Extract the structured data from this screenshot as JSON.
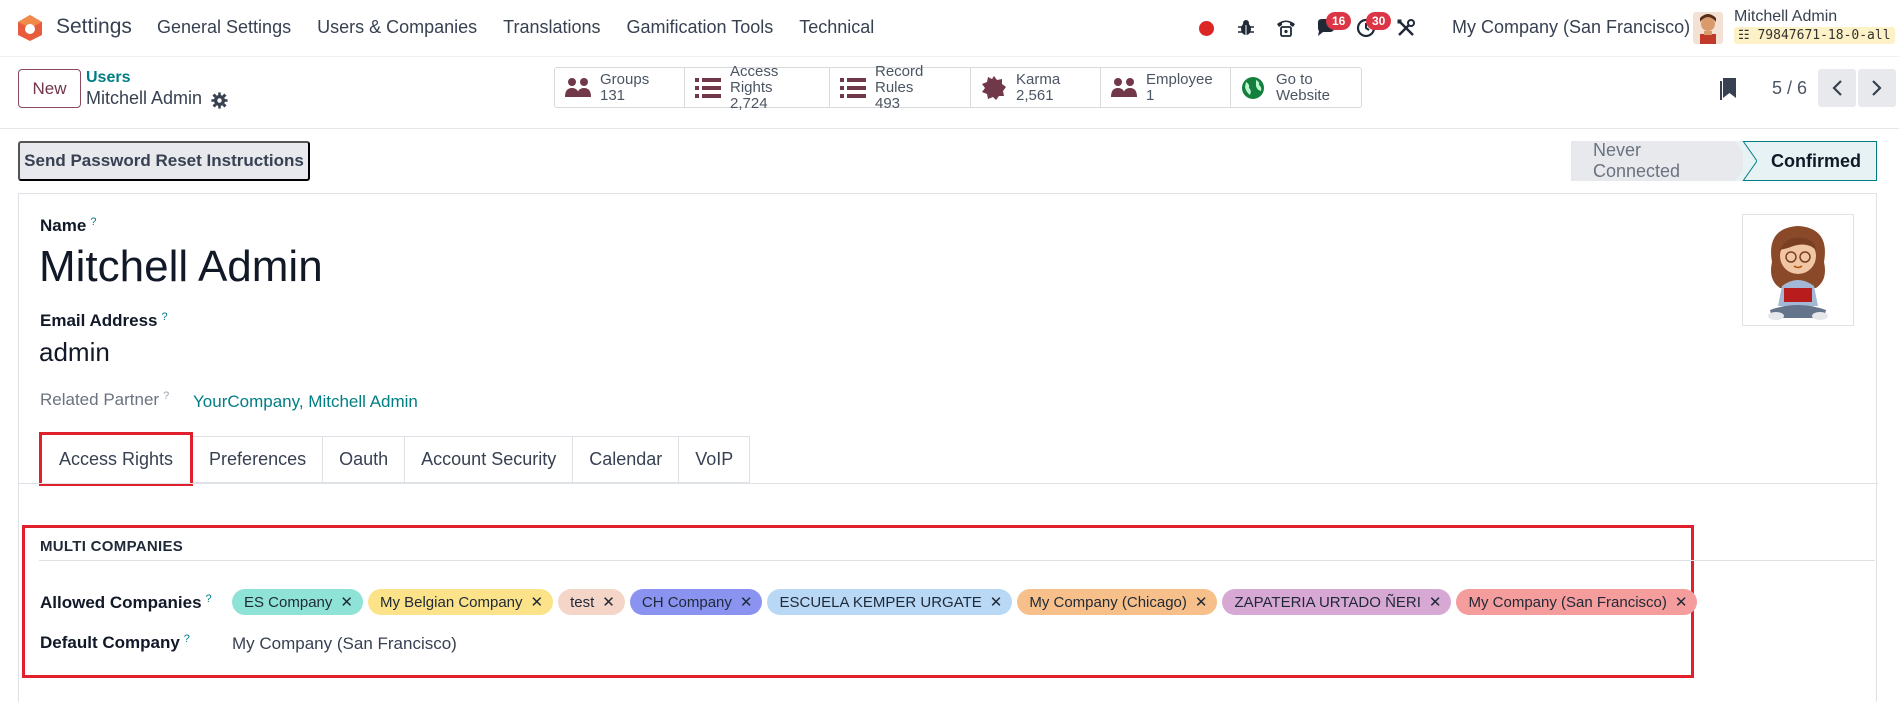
{
  "navbar": {
    "app_name": "Settings",
    "menu": [
      "General Settings",
      "Users & Companies",
      "Translations",
      "Gamification Tools",
      "Technical"
    ],
    "messages_count": "16",
    "activities_count": "30",
    "company": "My Company (San Francisco)",
    "user_name": "Mitchell Admin",
    "db_name": "79847671-18-0-all"
  },
  "control": {
    "new_label": "New",
    "breadcrumb_parent": "Users",
    "breadcrumb_current": "Mitchell Admin",
    "stats": [
      {
        "name": "groups",
        "label": "Groups",
        "value": "131"
      },
      {
        "name": "access-rights",
        "label": "Access Rights",
        "value": "2,724"
      },
      {
        "name": "record-rules",
        "label": "Record Rules",
        "value": "493"
      },
      {
        "name": "karma",
        "label": "Karma",
        "value": "2,561"
      },
      {
        "name": "employee",
        "label": "Employee",
        "value": "1"
      },
      {
        "name": "website",
        "label": "Go to",
        "value": "Website"
      }
    ],
    "pager": "5 / 6"
  },
  "header": {
    "reset_label": "Send Password Reset Instructions",
    "status_inactive": "Never Connected",
    "status_active": "Confirmed"
  },
  "form": {
    "name_label": "Name",
    "name_value": "Mitchell Admin",
    "email_label": "Email Address",
    "email_value": "admin",
    "partner_label": "Related Partner",
    "partner_value": "YourCompany, Mitchell Admin",
    "help_mark": "?",
    "tabs": [
      "Access Rights",
      "Preferences",
      "Oauth",
      "Account Security",
      "Calendar",
      "VoIP"
    ],
    "section_title": "MULTI COMPANIES",
    "allowed_label": "Allowed Companies",
    "default_label": "Default Company",
    "default_value": "My Company (San Francisco)",
    "allowed_companies": [
      {
        "label": "ES Company",
        "color": "#8ee3d6"
      },
      {
        "label": "My Belgian Company",
        "color": "#fce38a"
      },
      {
        "label": "test",
        "color": "#f6d5c9"
      },
      {
        "label": "CH Company",
        "color": "#8b93f0"
      },
      {
        "label": "ESCUELA KEMPER URGATE",
        "color": "#b8d8f6"
      },
      {
        "label": "My Company (Chicago)",
        "color": "#f7c08a"
      },
      {
        "label": "ZAPATERIA URTADO ÑERI",
        "color": "#d7a8d4"
      },
      {
        "label": "My Company (San Francisco)",
        "color": "#f59c9c"
      }
    ]
  }
}
